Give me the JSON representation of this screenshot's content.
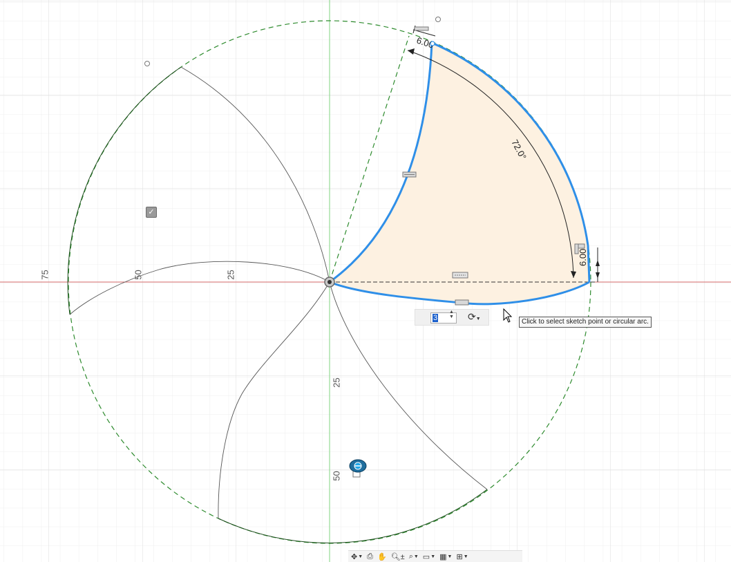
{
  "viewport": {
    "axis_labels": {
      "h_75": "75",
      "h_50": "50",
      "h_25": "25",
      "v_25": "25",
      "v_50": "50"
    },
    "dimensions": {
      "angle": "72.0°",
      "offset_top": "6.00",
      "offset_right": "6.00"
    },
    "colors": {
      "profile": "#2f8fe8",
      "profile_fill": "#fdf1e1",
      "construction": "#2e8b2e",
      "x_axis": "#d46a6a",
      "y_axis": "#7fd37f",
      "grid": "#e4e4e4"
    }
  },
  "pattern_input": {
    "value": "3",
    "rotation_icon": "rotate-icon"
  },
  "tooltip": "Click to select sketch point or circular arc.",
  "navigation_toolbar": {
    "items": [
      "orbit-icon",
      "look-at-icon",
      "pan-icon",
      "zoom-icon",
      "fit-icon",
      "display-settings-icon",
      "grid-settings-icon",
      "viewports-icon"
    ]
  }
}
